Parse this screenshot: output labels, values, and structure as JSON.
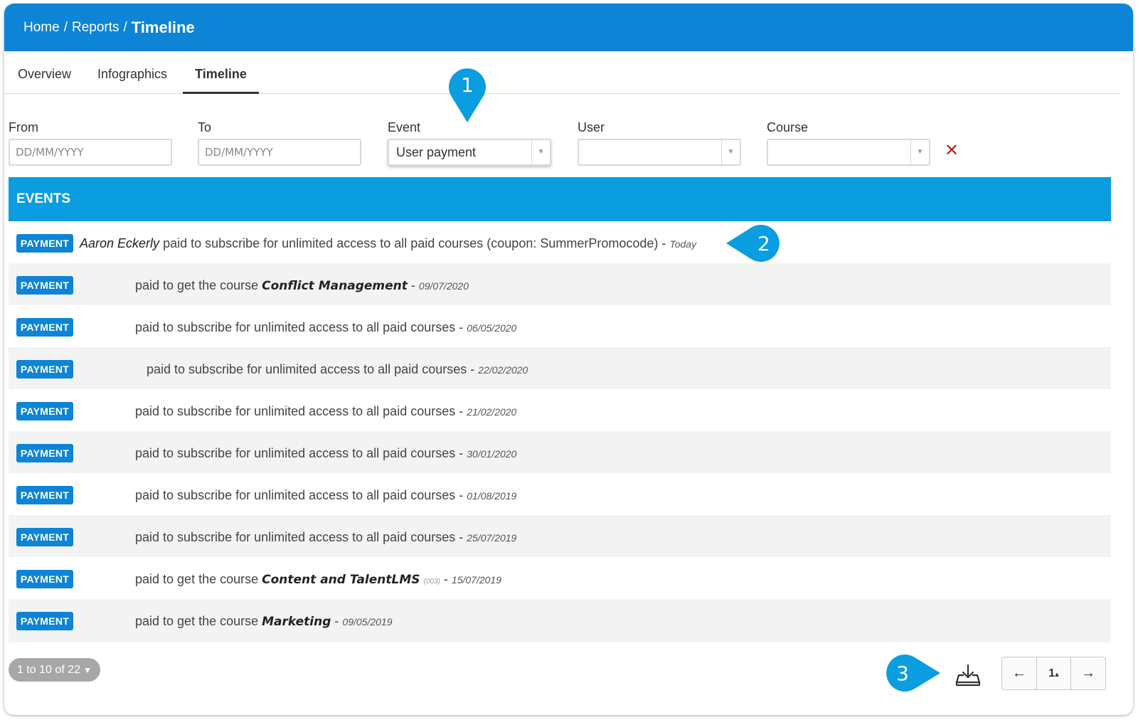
{
  "breadcrumb": {
    "home": "Home",
    "reports": "Reports",
    "separator": "/",
    "current": "Timeline"
  },
  "tabs": [
    {
      "label": "Overview"
    },
    {
      "label": "Infographics"
    },
    {
      "label": "Timeline",
      "active": true
    }
  ],
  "filters": {
    "from": {
      "label": "From",
      "placeholder": "DD/MM/YYYY",
      "value": ""
    },
    "to": {
      "label": "To",
      "placeholder": "DD/MM/YYYY",
      "value": ""
    },
    "event": {
      "label": "Event",
      "value": "User payment"
    },
    "user": {
      "label": "User",
      "value": ""
    },
    "course": {
      "label": "Course",
      "value": ""
    },
    "clear_icon": "close-icon",
    "clear_glyph": "✕"
  },
  "events": {
    "header": "EVENTS",
    "rows": [
      {
        "badge": "PAYMENT",
        "user": "Aaron Eckerly",
        "action": "paid to subscribe for unlimited access to all paid courses (coupon: SummerPromocode)",
        "dash": "-",
        "date": "Today"
      },
      {
        "badge": "PAYMENT",
        "action": "paid to get the course",
        "course": "Conflict Management",
        "dash": "-",
        "date": "09/07/2020"
      },
      {
        "badge": "PAYMENT",
        "action": "paid to subscribe for unlimited access to all paid courses",
        "dash": "-",
        "date": "06/05/2020"
      },
      {
        "badge": "PAYMENT",
        "action": "paid to subscribe for unlimited access to all paid courses",
        "dash": "-",
        "date": "22/02/2020"
      },
      {
        "badge": "PAYMENT",
        "action": "paid to subscribe for unlimited access to all paid courses",
        "dash": "-",
        "date": "21/02/2020"
      },
      {
        "badge": "PAYMENT",
        "action": "paid to subscribe for unlimited access to all paid courses",
        "dash": "-",
        "date": "30/01/2020"
      },
      {
        "badge": "PAYMENT",
        "action": "paid to subscribe for unlimited access to all paid courses",
        "dash": "-",
        "date": "01/08/2019"
      },
      {
        "badge": "PAYMENT",
        "action": "paid to subscribe for unlimited access to all paid courses",
        "dash": "-",
        "date": "25/07/2019"
      },
      {
        "badge": "PAYMENT",
        "action": "paid to get the course",
        "course": "Content and TalentLMS",
        "code": "(003)",
        "dash": "-",
        "date": "15/07/2019"
      },
      {
        "badge": "PAYMENT",
        "action": "paid to get the course",
        "course": "Marketing",
        "dash": "-",
        "date": "09/05/2019"
      }
    ]
  },
  "pagination": {
    "summary": "1 to 10 of 22",
    "prev": "←",
    "page": "1",
    "page_caret": "▴",
    "next": "→",
    "download_icon": "download-icon"
  },
  "markers": [
    "1",
    "2",
    "3"
  ],
  "colors": {
    "topbar": "#0d84d6",
    "events_header": "#0a9de0",
    "badge": "#0d84d6",
    "marker": "#0a9de0",
    "clear": "#bb2222"
  }
}
